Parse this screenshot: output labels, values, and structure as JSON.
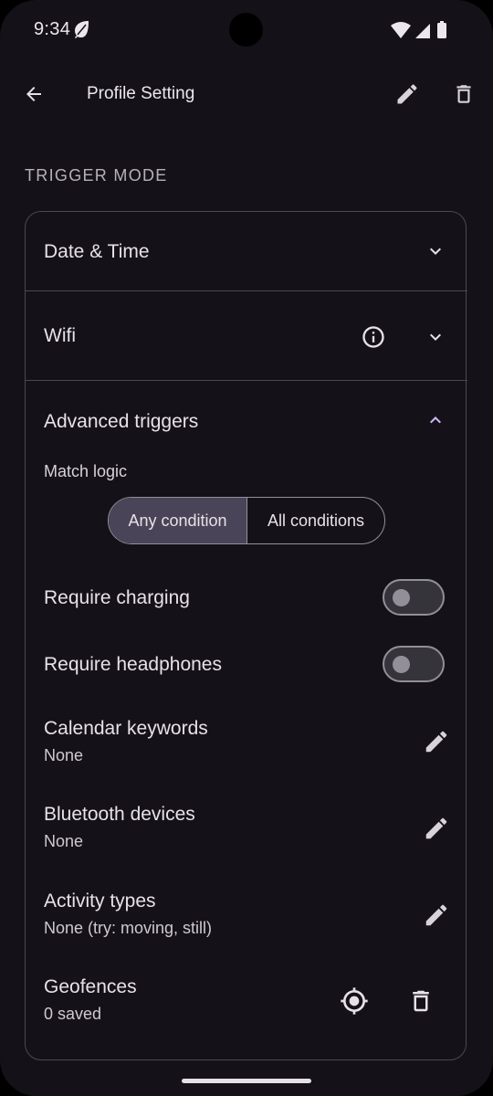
{
  "status_bar": {
    "time": "9:34"
  },
  "app_bar": {
    "title": "Profile Setting"
  },
  "section": {
    "label": "TRIGGER MODE"
  },
  "rows": {
    "date_time": "Date & Time",
    "wifi": "Wifi",
    "advanced": "Advanced triggers"
  },
  "advanced": {
    "match_logic_label": "Match logic",
    "segments": [
      "Any condition",
      "All conditions"
    ],
    "selected_segment": "Any condition",
    "require_charging": {
      "label": "Require charging",
      "on": false
    },
    "require_headphones": {
      "label": "Require headphones",
      "on": false
    },
    "calendar": {
      "title": "Calendar keywords",
      "value": "None"
    },
    "bluetooth": {
      "title": "Bluetooth devices",
      "value": "None"
    },
    "activity": {
      "title": "Activity types",
      "value": "None (try: moving, still)"
    },
    "geofences": {
      "title": "Geofences",
      "value": "0 saved"
    }
  },
  "icons": [
    "back-arrow-icon",
    "edit-icon",
    "delete-icon",
    "info-icon",
    "chevron-down-icon",
    "chevron-up-icon",
    "location-target-icon",
    "leaf-icon",
    "wifi-icon",
    "signal-icon",
    "battery-icon"
  ],
  "colors": {
    "background": "#141218",
    "accent": "#cfbcff",
    "selected_segment": "#4a4458",
    "outline": "#4c4751"
  }
}
